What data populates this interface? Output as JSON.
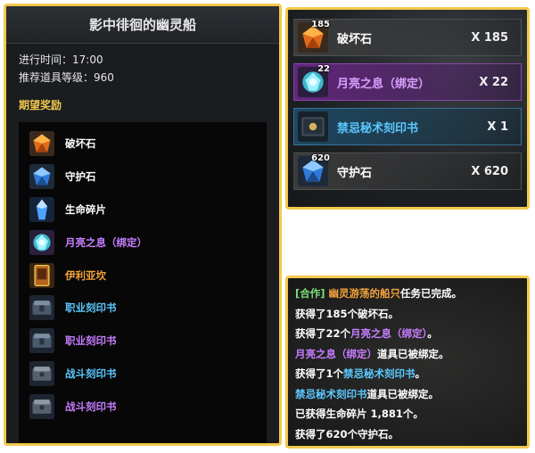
{
  "quest": {
    "title": "影中徘徊的幽灵船",
    "time_label": "进行时间：17:00",
    "level_label": "推荐道具等级：960",
    "rewards_label": "期望奖励"
  },
  "rewards": [
    {
      "name": "破坏石",
      "color": "#ffffff",
      "icon": "destruction-stone-icon"
    },
    {
      "name": "守护石",
      "color": "#ffffff",
      "icon": "guardian-stone-icon"
    },
    {
      "name": "生命碎片",
      "color": "#ffffff",
      "icon": "life-shard-icon"
    },
    {
      "name": "月亮之息（绑定）",
      "color": "#c77dff",
      "icon": "moon-breath-icon"
    },
    {
      "name": "伊利亚坎",
      "color": "#f2a23c",
      "icon": "illiakan-card-icon"
    },
    {
      "name": "职业刻印书",
      "color": "#5cc8ff",
      "icon": "class-engraving-book-icon"
    },
    {
      "name": "职业刻印书",
      "color": "#c77dff",
      "icon": "class-engraving-book-icon"
    },
    {
      "name": "战斗刻印书",
      "color": "#5cc8ff",
      "icon": "combat-engraving-book-icon"
    },
    {
      "name": "战斗刻印书",
      "color": "#c77dff",
      "icon": "combat-engraving-book-icon"
    }
  ],
  "loot": [
    {
      "badge": "185",
      "name": "破坏石",
      "qty": "X 185",
      "color": "#ffffff",
      "style": "",
      "icon": "destruction-stone-icon"
    },
    {
      "badge": "22",
      "name": "月亮之息（绑定）",
      "qty": "X 22",
      "color": "#d9a0ff",
      "style": "purple",
      "icon": "moon-breath-icon"
    },
    {
      "badge": "",
      "name": "禁忌秘术刻印书",
      "qty": "X 1",
      "color": "#5cc8ff",
      "style": "blue",
      "icon": "forbidden-engraving-book-icon"
    },
    {
      "badge": "620",
      "name": "守护石",
      "qty": "X 620",
      "color": "#ffffff",
      "style": "",
      "icon": "guardian-stone-icon"
    }
  ],
  "chat": [
    [
      {
        "t": "[合作] ",
        "c": "c-green"
      },
      {
        "t": "幽灵游荡的船只",
        "c": "c-orange"
      },
      {
        "t": "任务已完成。",
        "c": ""
      }
    ],
    [
      {
        "t": "获得了185个破坏石。",
        "c": ""
      }
    ],
    [
      {
        "t": "获得了22个",
        "c": ""
      },
      {
        "t": "月亮之息（绑定）",
        "c": "c-purple"
      },
      {
        "t": "。",
        "c": ""
      }
    ],
    [
      {
        "t": "月亮之息（绑定）",
        "c": "c-purple"
      },
      {
        "t": "道具已被绑定。",
        "c": ""
      }
    ],
    [
      {
        "t": "获得了1个",
        "c": ""
      },
      {
        "t": "禁忌秘术刻印书",
        "c": "c-blue"
      },
      {
        "t": "。",
        "c": ""
      }
    ],
    [
      {
        "t": "禁忌秘术刻印书",
        "c": "c-blue"
      },
      {
        "t": "道具已被绑定。",
        "c": ""
      }
    ],
    [
      {
        "t": "已获得生命碎片 1,881个。",
        "c": ""
      }
    ],
    [
      {
        "t": "获得了620个守护石。",
        "c": ""
      }
    ]
  ]
}
